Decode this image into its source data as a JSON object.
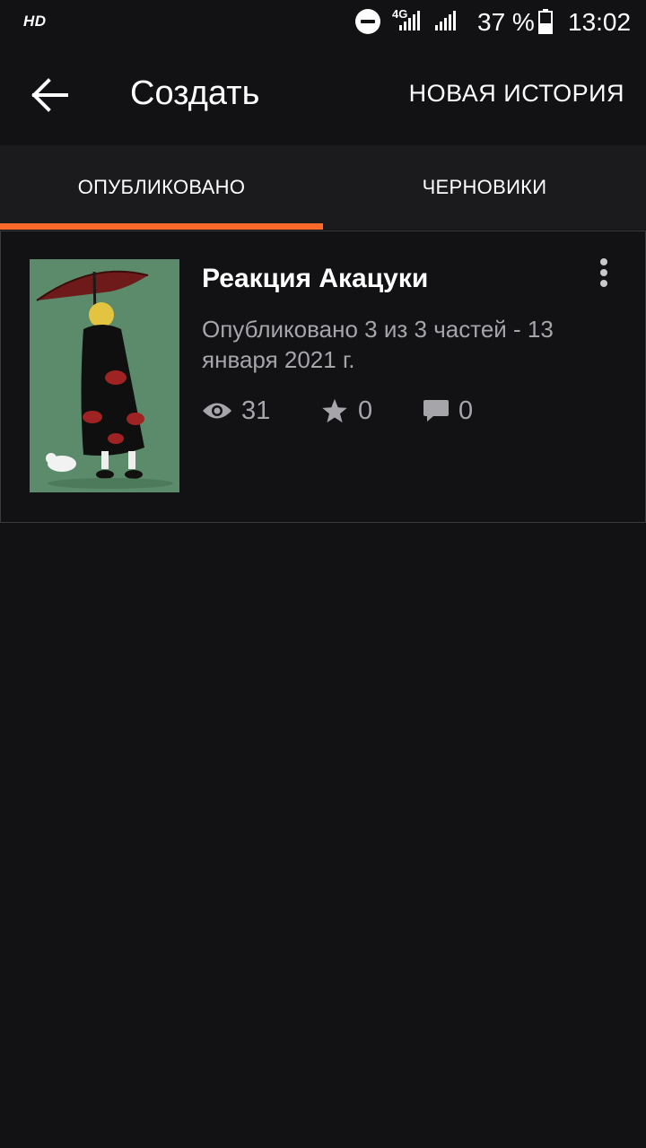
{
  "status_bar": {
    "hd": "HD",
    "network": "4G",
    "battery": "37 %",
    "time": "13:02"
  },
  "appbar": {
    "title": "Создать",
    "action": "НОВАЯ ИСТОРИЯ"
  },
  "tabs": [
    {
      "label": "ОПУБЛИКОВАНО",
      "active": true
    },
    {
      "label": "ЧЕРНОВИКИ",
      "active": false
    }
  ],
  "stories": [
    {
      "title": "Реакция Акацуки",
      "meta": "Опубликовано 3 из 3 частей - 13 января 2021 г.",
      "views": "31",
      "votes": "0",
      "comments": "0"
    }
  ],
  "colors": {
    "background": "#121114",
    "accent": "#ff6a2b",
    "muted": "#a6a5aa"
  }
}
